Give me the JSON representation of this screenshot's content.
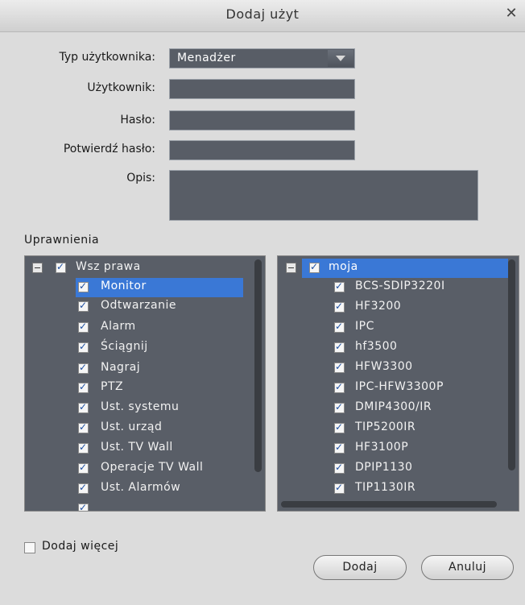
{
  "dialog": {
    "title": "Dodaj użyt",
    "close_glyph": "✕"
  },
  "form": {
    "user_type_label": "Typ użytkownika:",
    "user_type_value": "Menadżer",
    "user_label": "Użytkownik:",
    "user_value": "",
    "password_label": "Hasło:",
    "password_value": "",
    "confirm_label": "Potwierdź hasło:",
    "confirm_value": "",
    "description_label": "Opis:",
    "description_value": ""
  },
  "permissions": {
    "title": "Uprawnienia",
    "left_tree": {
      "root": "Wsz prawa",
      "items": [
        "Monitor",
        "Odtwarzanie",
        "Alarm",
        "Ściągnij",
        "Nagraj",
        "PTZ",
        "Ust. systemu",
        "Ust. urząd",
        "Ust. TV Wall",
        "Operacje TV Wall",
        "Ust. Alarmów"
      ],
      "selected": "Monitor"
    },
    "right_tree": {
      "root": "moja",
      "items": [
        "BCS-SDIP3220I",
        "HF3200",
        "IPC",
        "hf3500",
        "HFW3300",
        "IPC-HFW3300P",
        "DMIP4300/IR",
        "TIP5200IR",
        "HF3100P",
        "DPIP1130",
        "TIP1130IR"
      ],
      "selected": "moja"
    }
  },
  "add_more_label": "Dodaj więcej",
  "buttons": {
    "add": "Dodaj",
    "cancel": "Anuluj"
  },
  "colors": {
    "field_bg": "#585d66",
    "selection": "#3a78d6",
    "dialog_bg": "#dcdcdc"
  }
}
